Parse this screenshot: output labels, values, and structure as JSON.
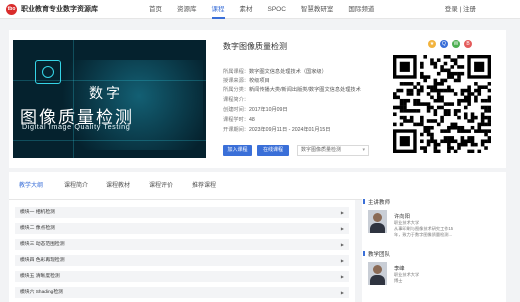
{
  "header": {
    "logo_mark": "tbo",
    "logo_text": "职业教育专业数字资源库",
    "nav": [
      "首页",
      "资源库",
      "课程",
      "素材",
      "SPOC",
      "智慧教研室",
      "国际频道"
    ],
    "active_nav": 2,
    "login": "登录",
    "separator": " | ",
    "register": "注册"
  },
  "course": {
    "cover": {
      "big": "数字",
      "title": "图像质量检测",
      "subtitle": "Digital Image Quality Testing"
    },
    "title": "数字图像质量检测",
    "meta": [
      {
        "k": "所属课程：",
        "v": "数字图文信息处理技术（国家级）",
        "blue": false
      },
      {
        "k": "授课来源：",
        "v": "校级项目",
        "blue": false
      },
      {
        "k": "所属分类：",
        "v": "新闻传播大类/新闻出版类/数字图文信息处理技术",
        "blue": false
      },
      {
        "k": "课程简介：",
        "v": "",
        "blue": false
      },
      {
        "k": "创建时间：",
        "v": "2017年10月09日",
        "blue": false
      },
      {
        "k": "课程学时：",
        "v": "48",
        "blue": false
      },
      {
        "k": "开课期间：",
        "v": "2023年09月11日 - 2024年01月15日",
        "blue": false
      }
    ],
    "join_button": "加入课程",
    "learn_button": "在线课程",
    "select_value": "数字图像质量检测"
  },
  "tabs": [
    "教学大纲",
    "课程简介",
    "课程教材",
    "课程评价",
    "推荐课程"
  ],
  "active_tab": 0,
  "chapters": [
    "模块一 相机检测",
    "模块二 像点检测",
    "模块三 动态范围检测",
    "模块四 色彩再现检测",
    "模块五 清晰度检测",
    "模块六 Shading检测"
  ],
  "sidebar": {
    "teacher_heading": "主讲教师",
    "teacher": {
      "name": "许向阳",
      "school": "职业技术大学",
      "desc1": "从事印刷与图像技术研究工作15",
      "desc2": "年，致力于数字图像质量检测..."
    },
    "team_heading": "教学团队",
    "member": {
      "name": "李峰",
      "school": "职业技术大学",
      "desc1": "博士"
    }
  },
  "colors": {
    "accent": "#3a6fd8",
    "cover_bg": "#05222e",
    "cover_line": "#35d4e6",
    "share": [
      "#f2b33d",
      "#3a6fd8",
      "#4caf50",
      "#e45b5b"
    ]
  },
  "icons": [
    "star-icon",
    "qq-icon",
    "wechat-icon",
    "weibo-icon",
    "chevron-down-icon"
  ]
}
